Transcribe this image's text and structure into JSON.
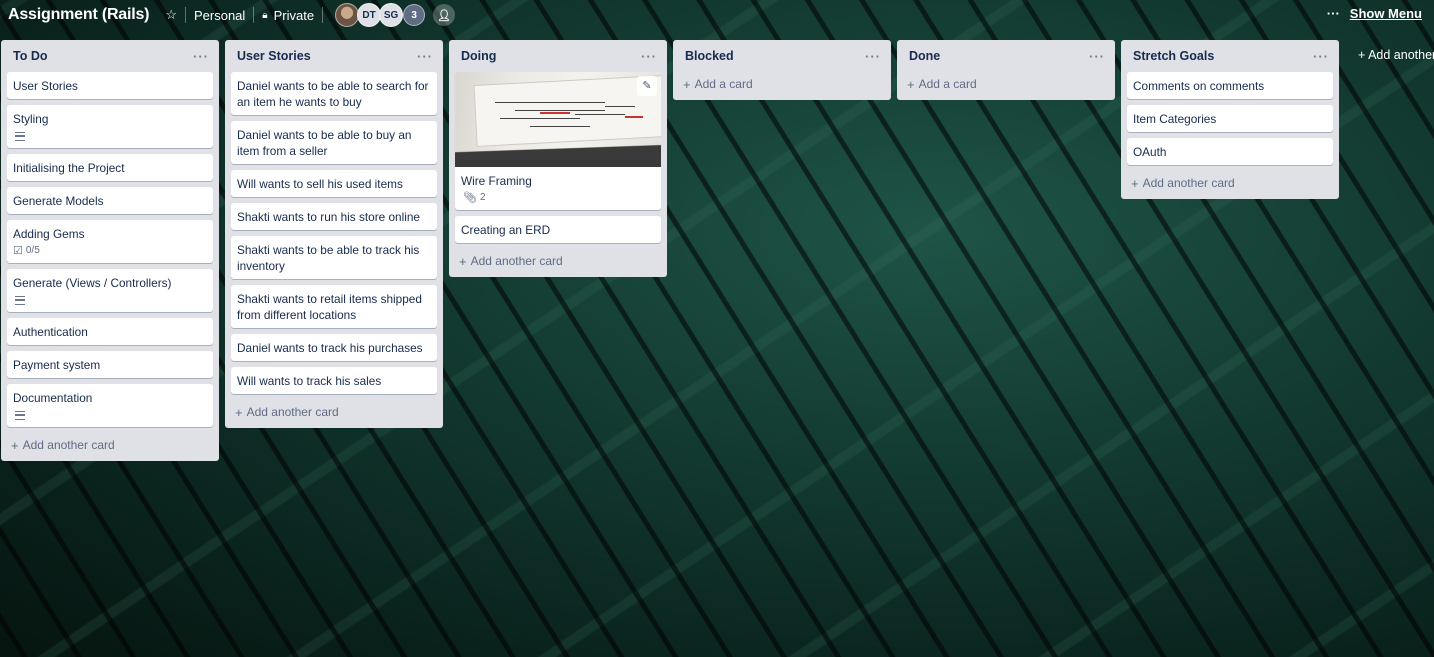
{
  "header": {
    "board_title": "Assignment (Rails)",
    "team": "Personal",
    "visibility": "Private",
    "members": [
      {
        "initials": "",
        "type": "photo"
      },
      {
        "initials": "DT"
      },
      {
        "initials": "SG"
      }
    ],
    "member_overflow": "3",
    "menu_dots": "···",
    "show_menu": "Show Menu"
  },
  "lists": [
    {
      "title": "To Do",
      "cards": [
        {
          "title": "User Stories"
        },
        {
          "title": "Styling",
          "description": true
        },
        {
          "title": "Initialising the Project"
        },
        {
          "title": "Generate Models"
        },
        {
          "title": "Adding Gems",
          "checklist": "0/5"
        },
        {
          "title": "Generate (Views / Controllers)",
          "description": true
        },
        {
          "title": "Authentication"
        },
        {
          "title": "Payment system"
        },
        {
          "title": "Documentation",
          "description": true
        }
      ],
      "add_label": "Add another card"
    },
    {
      "title": "User Stories",
      "cards": [
        {
          "title": "Daniel wants to be able to search for an item he wants to buy"
        },
        {
          "title": "Daniel wants to be able to buy an item from a seller"
        },
        {
          "title": "Will wants to sell his used items"
        },
        {
          "title": "Shakti wants to run his store online"
        },
        {
          "title": "Shakti wants to be able to track his inventory"
        },
        {
          "title": "Shakti wants to retail items shipped from different locations"
        },
        {
          "title": "Daniel wants to track his purchases"
        },
        {
          "title": "Will wants to track his sales"
        }
      ],
      "add_label": "Add another card"
    },
    {
      "title": "Doing",
      "cards": [
        {
          "title": "Wire Framing",
          "cover": true,
          "attachments": "2"
        },
        {
          "title": "Creating an ERD"
        }
      ],
      "add_label": "Add another card"
    },
    {
      "title": "Blocked",
      "cards": [],
      "add_label": "Add a card"
    },
    {
      "title": "Done",
      "cards": [],
      "add_label": "Add a card"
    },
    {
      "title": "Stretch Goals",
      "cards": [
        {
          "title": "Comments on comments"
        },
        {
          "title": "Item Categories"
        },
        {
          "title": "OAuth"
        }
      ],
      "add_label": "Add another card"
    }
  ],
  "add_list_label": "Add another list",
  "icons": {
    "star": "star-icon",
    "lock": "lock-icon",
    "add_member": "add-member-icon",
    "list_menu": "ellipsis-icon",
    "plus": "plus-icon",
    "description": "description-icon",
    "checklist": "checklist-icon",
    "attachment": "paperclip-icon",
    "edit": "pencil-icon"
  }
}
